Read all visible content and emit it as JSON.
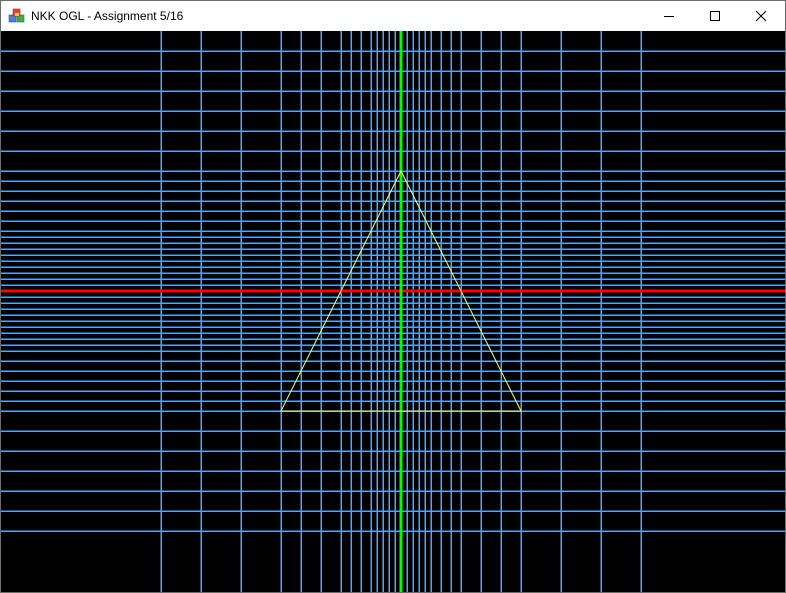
{
  "window": {
    "title": "NKK OGL - Assignment 5/16"
  },
  "icons": {
    "app": "app-cube-icon",
    "minimize": "minimize-icon",
    "maximize": "maximize-icon",
    "close": "close-icon"
  },
  "colors": {
    "background": "#000000",
    "grid": "#4da6ff",
    "x_axis": "#ff0000",
    "y_axis": "#00ff00",
    "triangle": "#ffff66"
  },
  "scene": {
    "shape": "triangle",
    "grid": "on"
  }
}
